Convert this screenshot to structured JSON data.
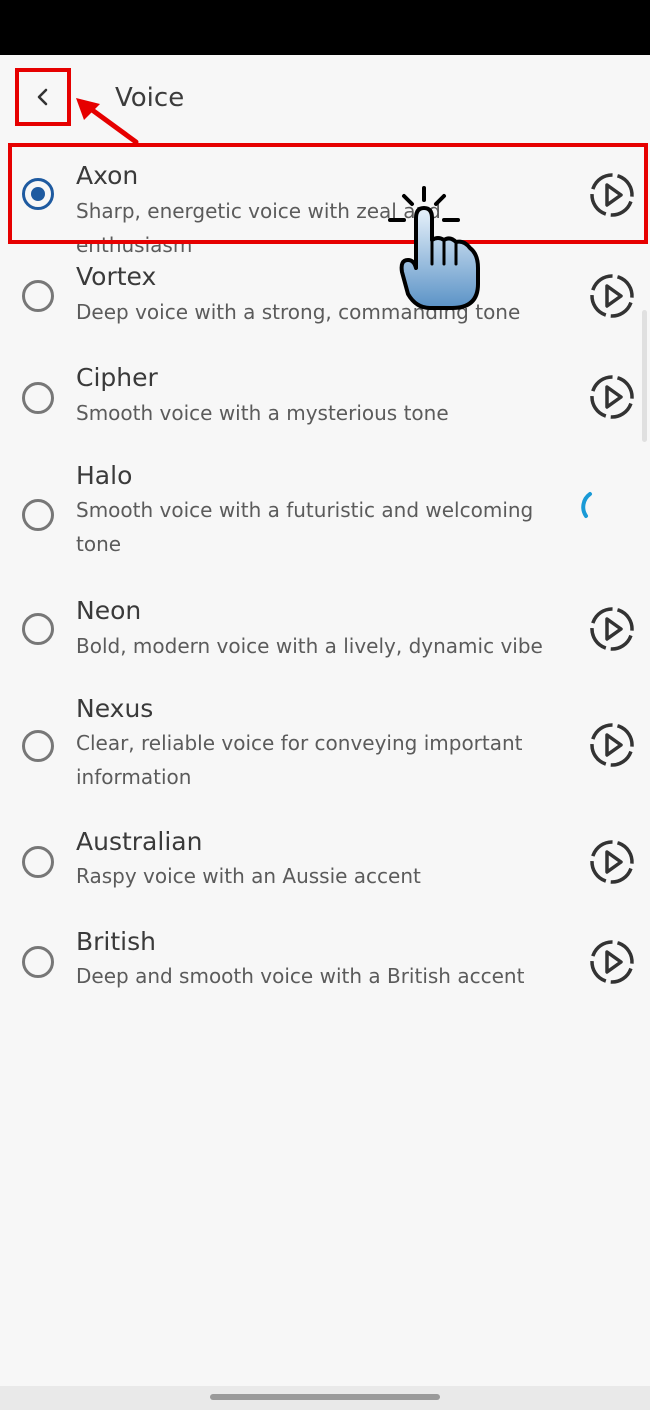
{
  "header": {
    "title": "Voice",
    "back_icon": "chevron-left-icon"
  },
  "colors": {
    "accent": "#1e5aa0",
    "annotation": "#e60000",
    "spinner": "#1a9ad6"
  },
  "voices": [
    {
      "name": "Axon",
      "description": "Sharp, energetic voice with zeal and enthusiasm",
      "selected": true,
      "action": "play-icon"
    },
    {
      "name": "Vortex",
      "description": "Deep voice with a strong, commanding tone",
      "selected": false,
      "action": "play-icon"
    },
    {
      "name": "Cipher",
      "description": "Smooth voice with a mysterious tone",
      "selected": false,
      "action": "play-icon"
    },
    {
      "name": "Halo",
      "description": "Smooth voice with a futuristic and welcoming tone",
      "selected": false,
      "action": "loading-spinner"
    },
    {
      "name": "Neon",
      "description": "Bold, modern voice with a lively, dynamic vibe",
      "selected": false,
      "action": "play-icon"
    },
    {
      "name": "Nexus",
      "description": "Clear, reliable voice for conveying important information",
      "selected": false,
      "action": "play-icon"
    },
    {
      "name": "Australian",
      "description": "Raspy voice with an Aussie accent",
      "selected": false,
      "action": "play-icon"
    },
    {
      "name": "British",
      "description": "Deep and smooth voice with a British accent",
      "selected": false,
      "action": "play-icon"
    }
  ]
}
